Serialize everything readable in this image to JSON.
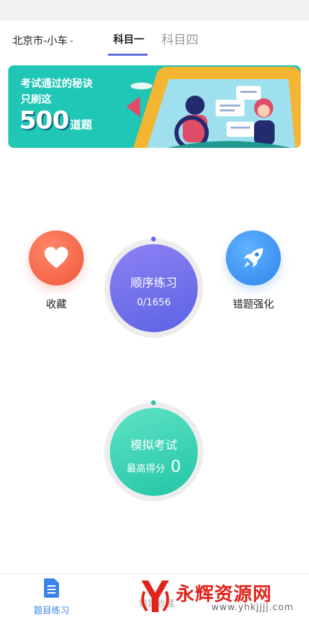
{
  "header": {
    "city": "北京市-小车",
    "tabs": [
      {
        "label": "科目一",
        "active": true
      },
      {
        "label": "科目四",
        "active": false
      }
    ]
  },
  "banner": {
    "line1": "考试通过的秘诀",
    "line2": "只刷这",
    "number": "500",
    "unit": "道题"
  },
  "features": {
    "favorites": {
      "label": "收藏",
      "icon": "heart-icon"
    },
    "wrong_review": {
      "label": "错题强化",
      "icon": "rocket-icon"
    }
  },
  "sequential": {
    "title": "顺序练习",
    "progress": "0/1656"
  },
  "mock_exam": {
    "title": "模拟考试",
    "score_label": "最高得分",
    "score": "0"
  },
  "bottom_nav": [
    {
      "label": "题目练习",
      "icon": "document-icon",
      "active": true
    },
    {
      "label": "错题收藏",
      "active": false
    }
  ],
  "watermark": {
    "text": "永辉资源网",
    "url": "www.yhkjjjj.com"
  },
  "colors": {
    "accent": "#5a6ad8",
    "banner": "#20c6b6",
    "favorite": "#f0553a",
    "wrong": "#2f84ea",
    "sequential": "#6a6ee6",
    "mock": "#21c5a6",
    "nav_active": "#3a84e8"
  }
}
